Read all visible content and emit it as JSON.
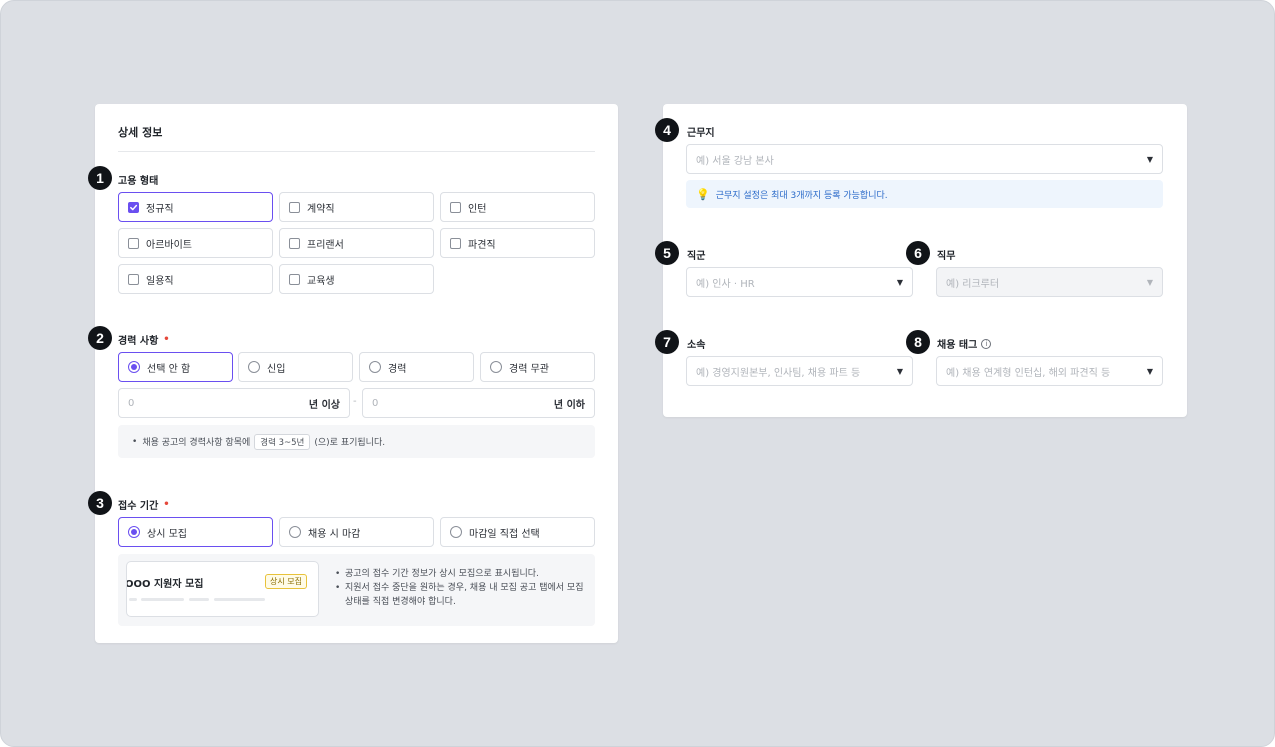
{
  "left_card": {
    "title": "상세 정보",
    "employment": {
      "badge": "1",
      "label": "고용 형태",
      "options": [
        {
          "label": "정규직",
          "checked": true
        },
        {
          "label": "계약직",
          "checked": false
        },
        {
          "label": "인턴",
          "checked": false
        },
        {
          "label": "아르바이트",
          "checked": false
        },
        {
          "label": "프리랜서",
          "checked": false
        },
        {
          "label": "파견직",
          "checked": false
        },
        {
          "label": "일용직",
          "checked": false
        },
        {
          "label": "교육생",
          "checked": false
        }
      ]
    },
    "career": {
      "badge": "2",
      "label": "경력 사항",
      "required_mark": "•",
      "options": [
        {
          "label": "선택 안 함",
          "selected": true
        },
        {
          "label": "신입",
          "selected": false
        },
        {
          "label": "경력",
          "selected": false
        },
        {
          "label": "경력 무관",
          "selected": false
        }
      ],
      "min_placeholder": "0",
      "min_unit": "년 이상",
      "range_sep": "-",
      "max_placeholder": "0",
      "max_unit": "년 이하",
      "note_prefix": "채용 공고의 경력사항 항목에",
      "note_chip": "경력 3~5년",
      "note_suffix": "(으)로 표기됩니다."
    },
    "period": {
      "badge": "3",
      "label": "접수 기간",
      "required_mark": "•",
      "options": [
        {
          "label": "상시 모집",
          "selected": true
        },
        {
          "label": "채용 시 마감",
          "selected": false
        },
        {
          "label": "마감일 직접 선택",
          "selected": false
        }
      ],
      "preview_title": "OOO 지원자 모집",
      "preview_badge": "상시 모집",
      "bullets": [
        "공고의 접수 기간 정보가 상시 모집으로 표시됩니다.",
        "지원서 접수 중단을 원하는 경우, 채용 내 모집 공고 탭에서 모집 상태를 직접 변경해야 합니다."
      ]
    }
  },
  "right_card": {
    "location": {
      "badge": "4",
      "label": "근무지",
      "placeholder": "예) 서울 강남 본사",
      "tip": "근무지 설정은 최대 3개까지 등록 가능합니다."
    },
    "job_group": {
      "badge": "5",
      "label": "직군",
      "placeholder": "예) 인사 · HR"
    },
    "job_role": {
      "badge": "6",
      "label": "직무",
      "placeholder": "예) 리크루터"
    },
    "affiliation": {
      "badge": "7",
      "label": "소속",
      "placeholder": "예) 경영지원본부, 인사팀, 채용 파트 등"
    },
    "hiring_tag": {
      "badge": "8",
      "label": "채용 태그",
      "info": "i",
      "placeholder": "예) 채용 연계형 인턴십, 해외 파견직 등"
    }
  },
  "colors": {
    "accent": "#6a4ff0",
    "required": "#e5483b",
    "tip_text": "#2a6ac9",
    "background": "#dcdfe4"
  }
}
